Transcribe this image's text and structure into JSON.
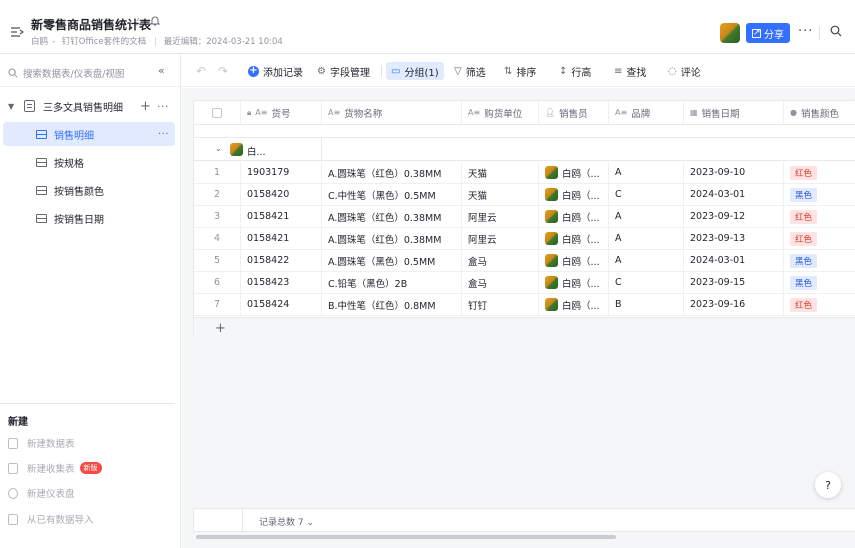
{
  "header": {
    "title": "新零售商品销售统计表",
    "owner": "白鸥",
    "source": "钉钉Office套件的文档",
    "last_edited": "最近编辑：2024-03-21 10:04",
    "share_label": "分享"
  },
  "sidebar": {
    "search_placeholder": "搜索数据表/仪表盘/视图",
    "database_name": "三多文具销售明细",
    "views": [
      {
        "label": "销售明细",
        "active": true
      },
      {
        "label": "按规格",
        "active": false
      },
      {
        "label": "按销售颜色",
        "active": false
      },
      {
        "label": "按销售日期",
        "active": false
      }
    ],
    "new_title": "新建",
    "new_items": [
      {
        "label": "新建数据表"
      },
      {
        "label": "新建收集表",
        "badge": "新版"
      },
      {
        "label": "新建仪表盘"
      },
      {
        "label": "从已有数据导入"
      }
    ]
  },
  "toolbar": {
    "add_record": "添加记录",
    "field_manage": "字段管理",
    "group": "分组(1)",
    "filter": "筛选",
    "sort": "排序",
    "row_height": "行高",
    "find": "查找",
    "comment": "评论"
  },
  "table": {
    "columns": [
      "货号",
      "货物名称",
      "购货单位",
      "销售员",
      "品牌",
      "销售日期",
      "销售颜色"
    ],
    "group_label": "白...",
    "rows": [
      {
        "n": "1",
        "code": "1903179",
        "name": "A.圆珠笔（红色）0.38MM",
        "buyer": "天猫",
        "seller": "白鸥（...",
        "brand": "A",
        "date": "2023-09-10",
        "color": "红色",
        "color_type": "red"
      },
      {
        "n": "2",
        "code": "0158420",
        "name": "C.中性笔（黑色）0.5MM",
        "buyer": "天猫",
        "seller": "白鸥（...",
        "brand": "C",
        "date": "2024-03-01",
        "color": "黑色",
        "color_type": "black"
      },
      {
        "n": "3",
        "code": "0158421",
        "name": "A.圆珠笔（红色）0.38MM",
        "buyer": "阿里云",
        "seller": "白鸥（...",
        "brand": "A",
        "date": "2023-09-12",
        "color": "红色",
        "color_type": "red"
      },
      {
        "n": "4",
        "code": "0158421",
        "name": "A.圆珠笔（红色）0.38MM",
        "buyer": "阿里云",
        "seller": "白鸥（...",
        "brand": "A",
        "date": "2023-09-13",
        "color": "红色",
        "color_type": "red"
      },
      {
        "n": "5",
        "code": "0158422",
        "name": "A.圆珠笔（黑色）0.5MM",
        "buyer": "盒马",
        "seller": "白鸥（...",
        "brand": "A",
        "date": "2024-03-01",
        "color": "黑色",
        "color_type": "black"
      },
      {
        "n": "6",
        "code": "0158423",
        "name": "C.铅笔（黑色）2B",
        "buyer": "盒马",
        "seller": "白鸥（...",
        "brand": "C",
        "date": "2023-09-15",
        "color": "黑色",
        "color_type": "black"
      },
      {
        "n": "7",
        "code": "0158424",
        "name": "B.中性笔（红色）0.8MM",
        "buyer": "钉钉",
        "seller": "白鸥（...",
        "brand": "B",
        "date": "2023-09-16",
        "color": "红色",
        "color_type": "red"
      }
    ]
  },
  "footer": {
    "record_total": "记录总数 7"
  },
  "colors": {
    "accent": "#3370ff",
    "tag_red_bg": "#fee3e2",
    "tag_black_bg": "#e1eaff"
  }
}
